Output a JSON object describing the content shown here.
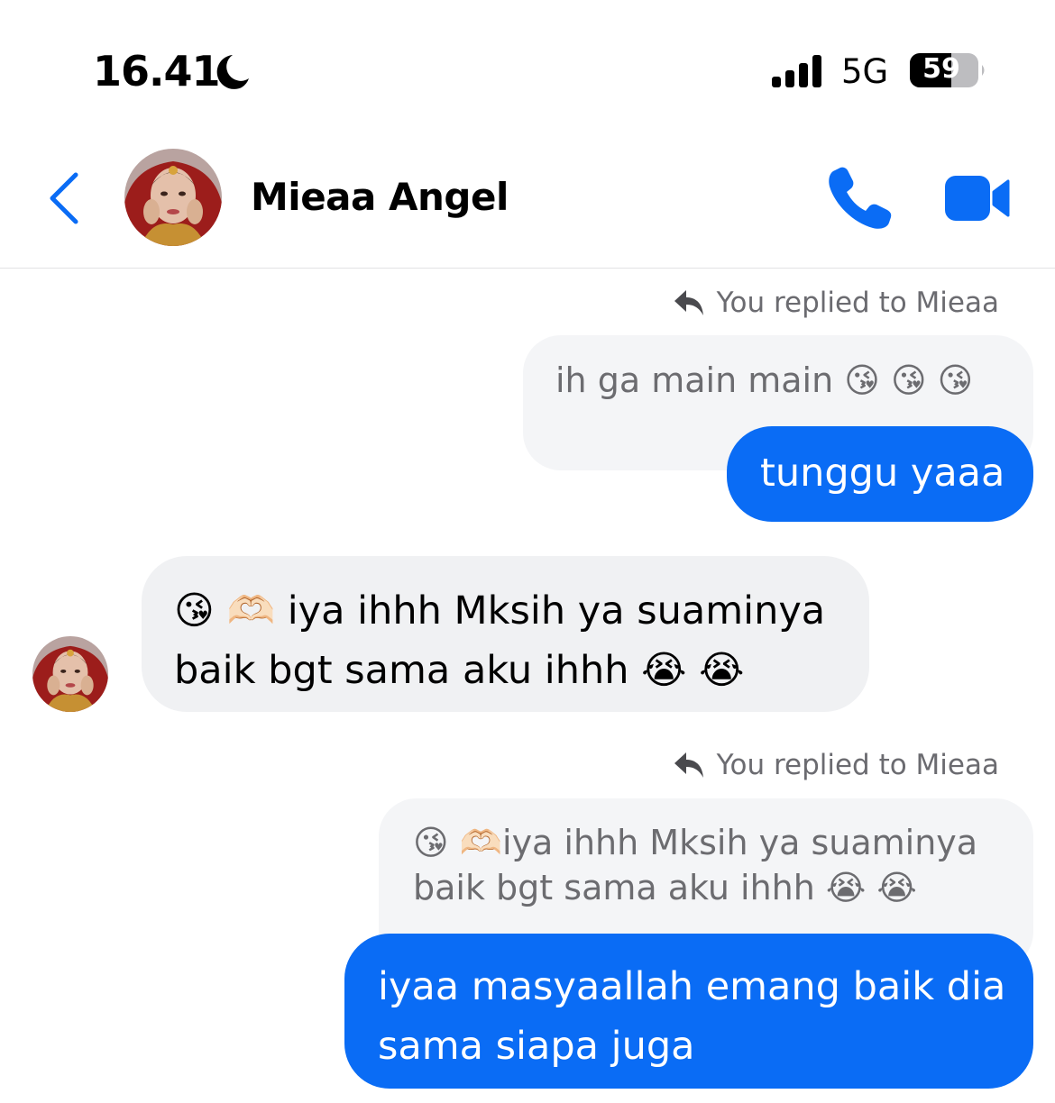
{
  "status_bar": {
    "time": "16.41",
    "network": "5G",
    "battery": "59",
    "icons": [
      "moon-icon",
      "signal-icon",
      "battery-icon"
    ]
  },
  "header": {
    "contact_name": "Mieaa Angel",
    "icons": [
      "back-chevron-icon",
      "phone-icon",
      "video-camera-icon"
    ],
    "accent_color": "#0a6cf5"
  },
  "messages": [
    {
      "reply_label": "You replied to Mieaa",
      "quoted_text": "ih ga main main 😘 😘 😘",
      "text": "tunggu yaaa",
      "direction": "outgoing"
    },
    {
      "text_line1": "😘 🫶🏻 iya ihhh Mksih ya suaminya",
      "text_line2": "baik bgt sama aku ihhh 😭 😭",
      "direction": "incoming"
    },
    {
      "reply_label": "You replied to Mieaa",
      "quoted_line1": "😘 🫶🏻iya ihhh Mksih ya suaminya",
      "quoted_line2": "baik bgt sama aku ihhh 😭 😭",
      "text_line1": "iyaa masyaallah emang baik dia",
      "text_line2": "sama siapa juga",
      "direction": "outgoing"
    }
  ]
}
